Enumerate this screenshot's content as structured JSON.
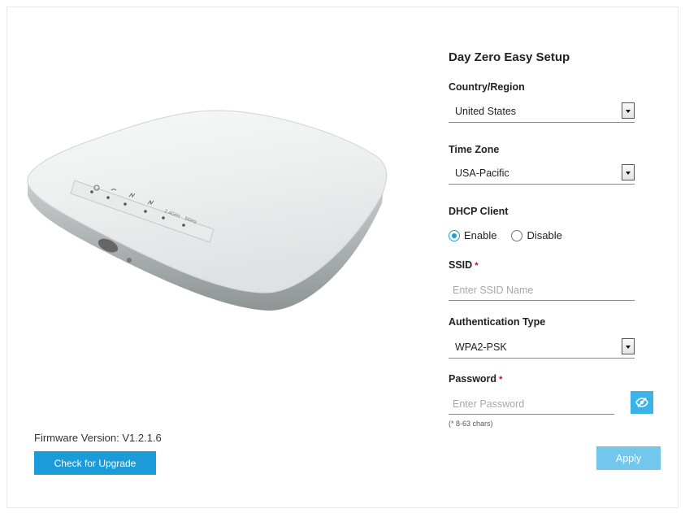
{
  "device": {
    "led_labels": [
      "2.4GHz",
      "5GHz"
    ]
  },
  "firmware": {
    "label": "Firmware Version: V1.2.1.6",
    "check_button": "Check for Upgrade"
  },
  "form": {
    "title": "Day Zero Easy Setup",
    "country": {
      "label": "Country/Region",
      "value": "United States"
    },
    "timezone": {
      "label": "Time Zone",
      "value": "USA-Pacific"
    },
    "dhcp": {
      "label": "DHCP Client",
      "enable": "Enable",
      "disable": "Disable",
      "selected": "Enable"
    },
    "ssid": {
      "label": "SSID",
      "required_mark": "*",
      "placeholder": "Enter SSID Name",
      "value": ""
    },
    "auth": {
      "label": "Authentication Type",
      "value": "WPA2-PSK"
    },
    "password": {
      "label": "Password",
      "required_mark": "*",
      "placeholder": "Enter Password",
      "value": "",
      "hint": "(* 8-63 chars)"
    },
    "apply_button": "Apply"
  },
  "colors": {
    "primary": "#1b9bd8",
    "apply_disabled": "#74c7ec",
    "required": "#d0021b"
  },
  "icons": {
    "toggle_password": "eye-slash-icon",
    "select_arrow": "chevron-down-icon"
  }
}
